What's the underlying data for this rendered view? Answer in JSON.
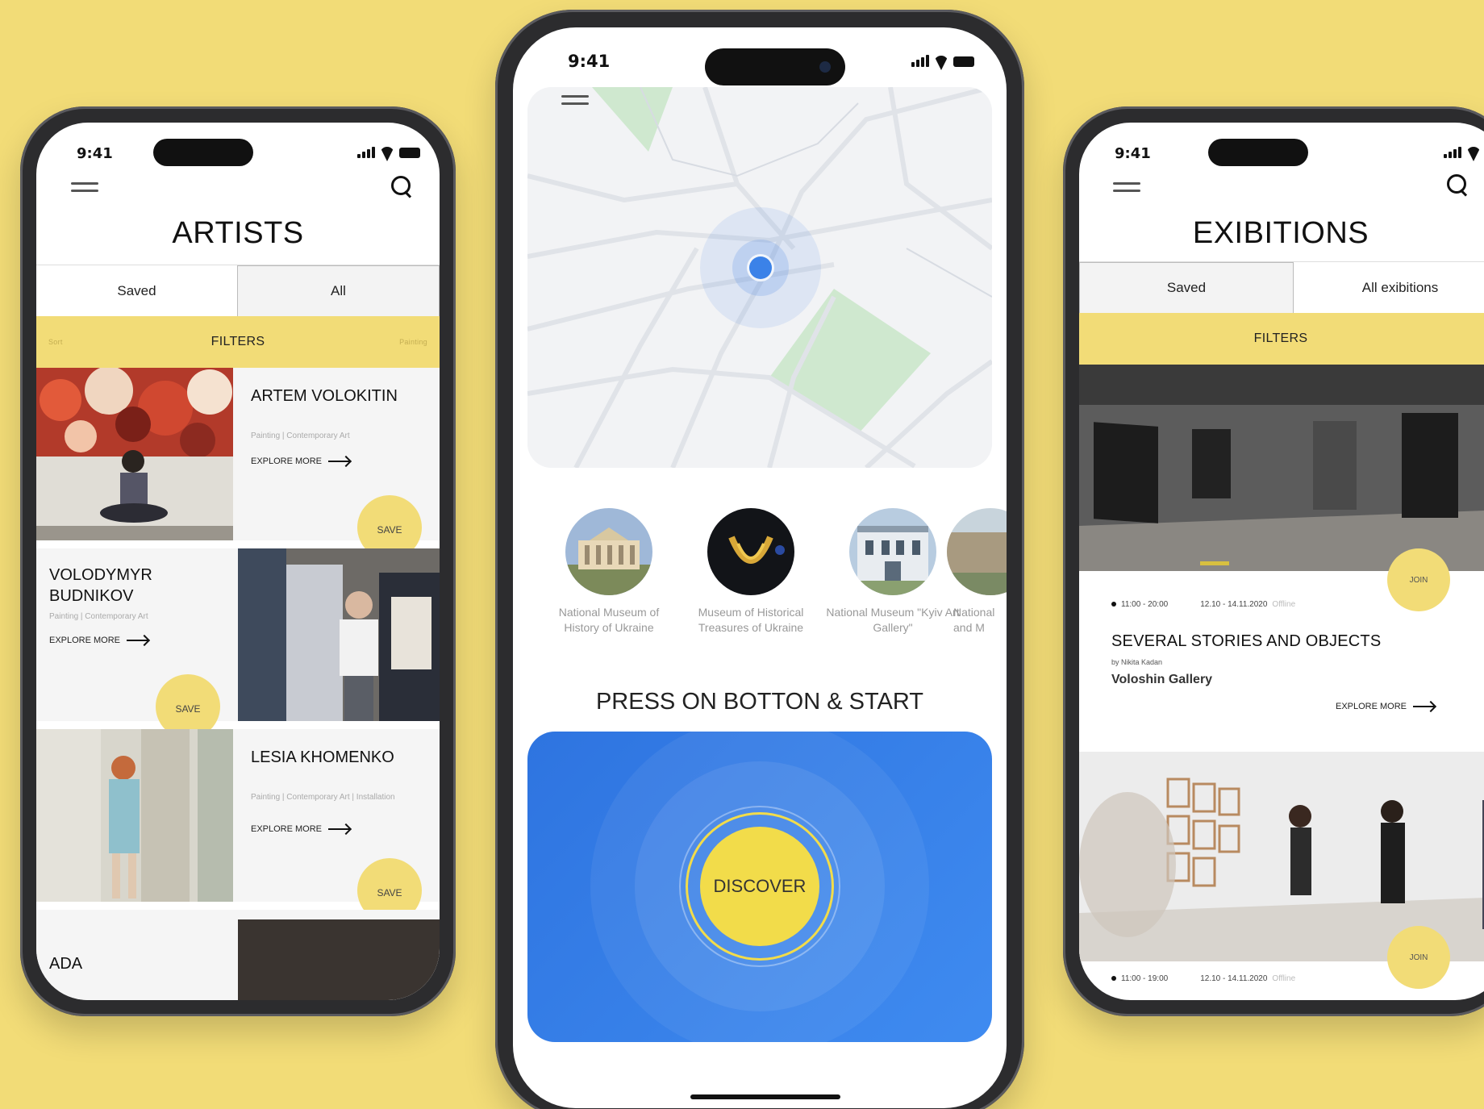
{
  "colors": {
    "background": "#f2dc77",
    "accent_yellow": "#f2dc77",
    "discover_blue": "#3b82e8"
  },
  "status": {
    "time": "9:41"
  },
  "artists_screen": {
    "title": "ARTISTS",
    "tabs": [
      "Saved",
      "All"
    ],
    "active_tab": "All",
    "filters_label": "FILTERS",
    "filters_left_faint": "Sort",
    "filters_right_faint": "Painting",
    "artists": [
      {
        "name": "ARTEM VOLOKITIN",
        "sub": "Painting | Contemporary Art",
        "explore": "EXPLORE MORE",
        "save": "SAVE"
      },
      {
        "name": "VOLODYMYR BUDNIKOV",
        "sub": "Painting | Contemporary Art",
        "explore": "EXPLORE MORE",
        "save": "SAVE"
      },
      {
        "name": "LESIA KHOMENKO",
        "sub": "Painting | Contemporary Art | Installation",
        "explore": "EXPLORE MORE",
        "save": "SAVE"
      },
      {
        "name": "ADA"
      }
    ]
  },
  "map_screen": {
    "museums": [
      {
        "label": "National Museum of History of Ukraine"
      },
      {
        "label": "Museum of Historical Treasures of Ukraine"
      },
      {
        "label": "National Museum \"Kyiv Art Gallery\""
      },
      {
        "label": "National\nand M"
      }
    ],
    "cta": "PRESS ON BOTTON & START",
    "discover": "DISCOVER"
  },
  "exhibitions_screen": {
    "title": "EXIBITIONS",
    "tabs": [
      "Saved",
      "All exibitions"
    ],
    "active_tab": "Saved",
    "filters_label": "FILTERS",
    "items": [
      {
        "hours": "11:00 - 20:00",
        "dates": "12.10 - 14.11.2020",
        "mode": "Offline",
        "title": "SEVERAL STORIES AND OBJECTS",
        "by": "by Nikita Kadan",
        "gallery": "Voloshin Gallery",
        "explore": "EXPLORE MORE",
        "join": "JOIN"
      },
      {
        "hours": "11:00 - 19:00",
        "dates": "12.10 - 14.11.2020",
        "mode": "Offline",
        "join": "JOIN"
      }
    ]
  }
}
